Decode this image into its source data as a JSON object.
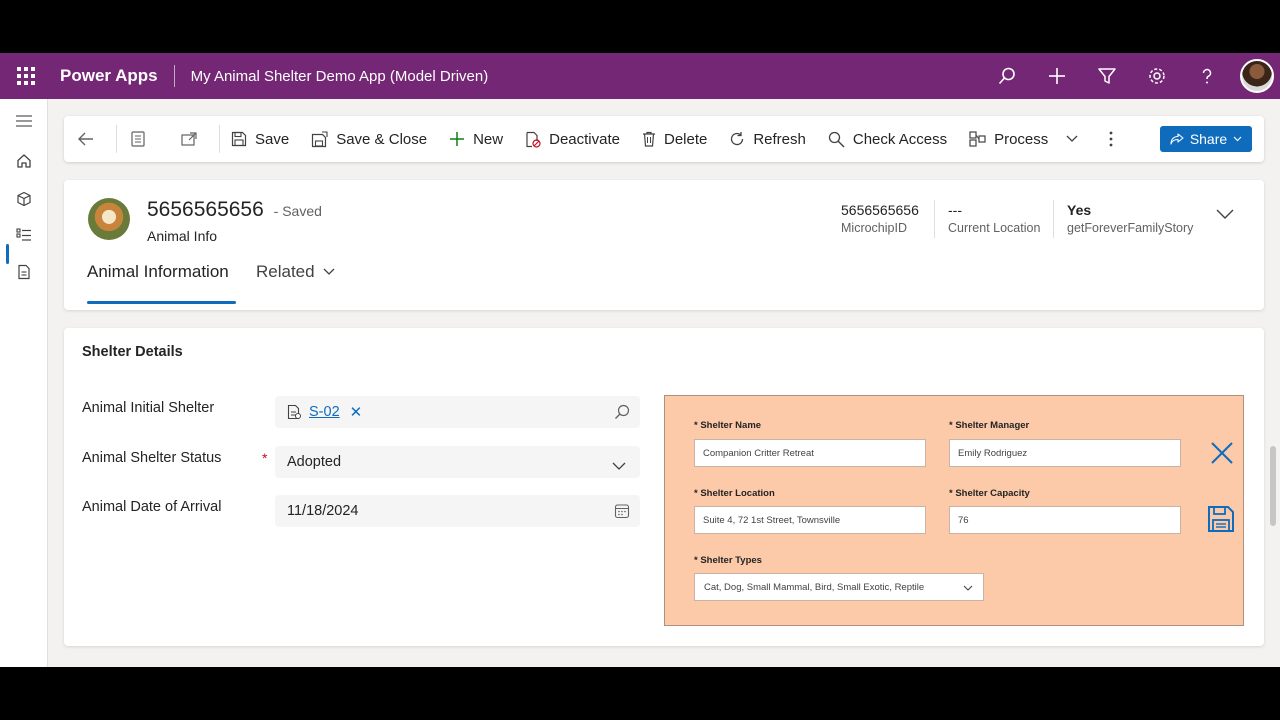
{
  "app": {
    "brand": "Power Apps",
    "title": "My Animal Shelter Demo App (Model Driven)"
  },
  "top_icons": [
    "search-icon",
    "add-icon",
    "filter-icon",
    "settings-icon",
    "help-icon",
    "user-avatar"
  ],
  "rail": [
    "hamburger-icon",
    "home-icon",
    "entity-icon",
    "list-icon",
    "report-icon"
  ],
  "commands": {
    "save": "Save",
    "save_close": "Save & Close",
    "new": "New",
    "deactivate": "Deactivate",
    "delete": "Delete",
    "refresh": "Refresh",
    "check_access": "Check Access",
    "process": "Process",
    "share": "Share"
  },
  "record": {
    "title": "5656565656",
    "saved": "- Saved",
    "form": "Animal Info",
    "header_fields": [
      {
        "value": "5656565656",
        "label": "MicrochipID"
      },
      {
        "value": "---",
        "label": "Current Location"
      },
      {
        "value": "Yes",
        "label": "getForeverFamilyStory"
      }
    ],
    "tabs": {
      "active": "Animal Information",
      "related": "Related"
    }
  },
  "section": {
    "title": "Shelter Details",
    "fields": {
      "initial_shelter_label": "Animal Initial Shelter",
      "initial_shelter_value": "S-02",
      "status_label": "Animal Shelter Status",
      "status_required": "*",
      "status_value": "Adopted",
      "arrival_label": "Animal Date of Arrival",
      "arrival_value": "11/18/2024"
    }
  },
  "canvas": {
    "name_label": "* Shelter Name",
    "name_value": "Companion Critter Retreat",
    "manager_label": "* Shelter Manager",
    "manager_value": "Emily Rodriguez",
    "location_label": "* Shelter Location",
    "location_value": "Suite 4, 72 1st Street, Townsville",
    "capacity_label": "* Shelter Capacity",
    "capacity_value": "76",
    "types_label": "* Shelter Types",
    "types_value": "Cat, Dog, Small Mammal, Bird, Small Exotic, Reptile"
  },
  "colors": {
    "topbar": "#742774",
    "accent": "#0f6cbd",
    "canvas_bg": "#fcc9a9",
    "required": "#c50f1f"
  }
}
